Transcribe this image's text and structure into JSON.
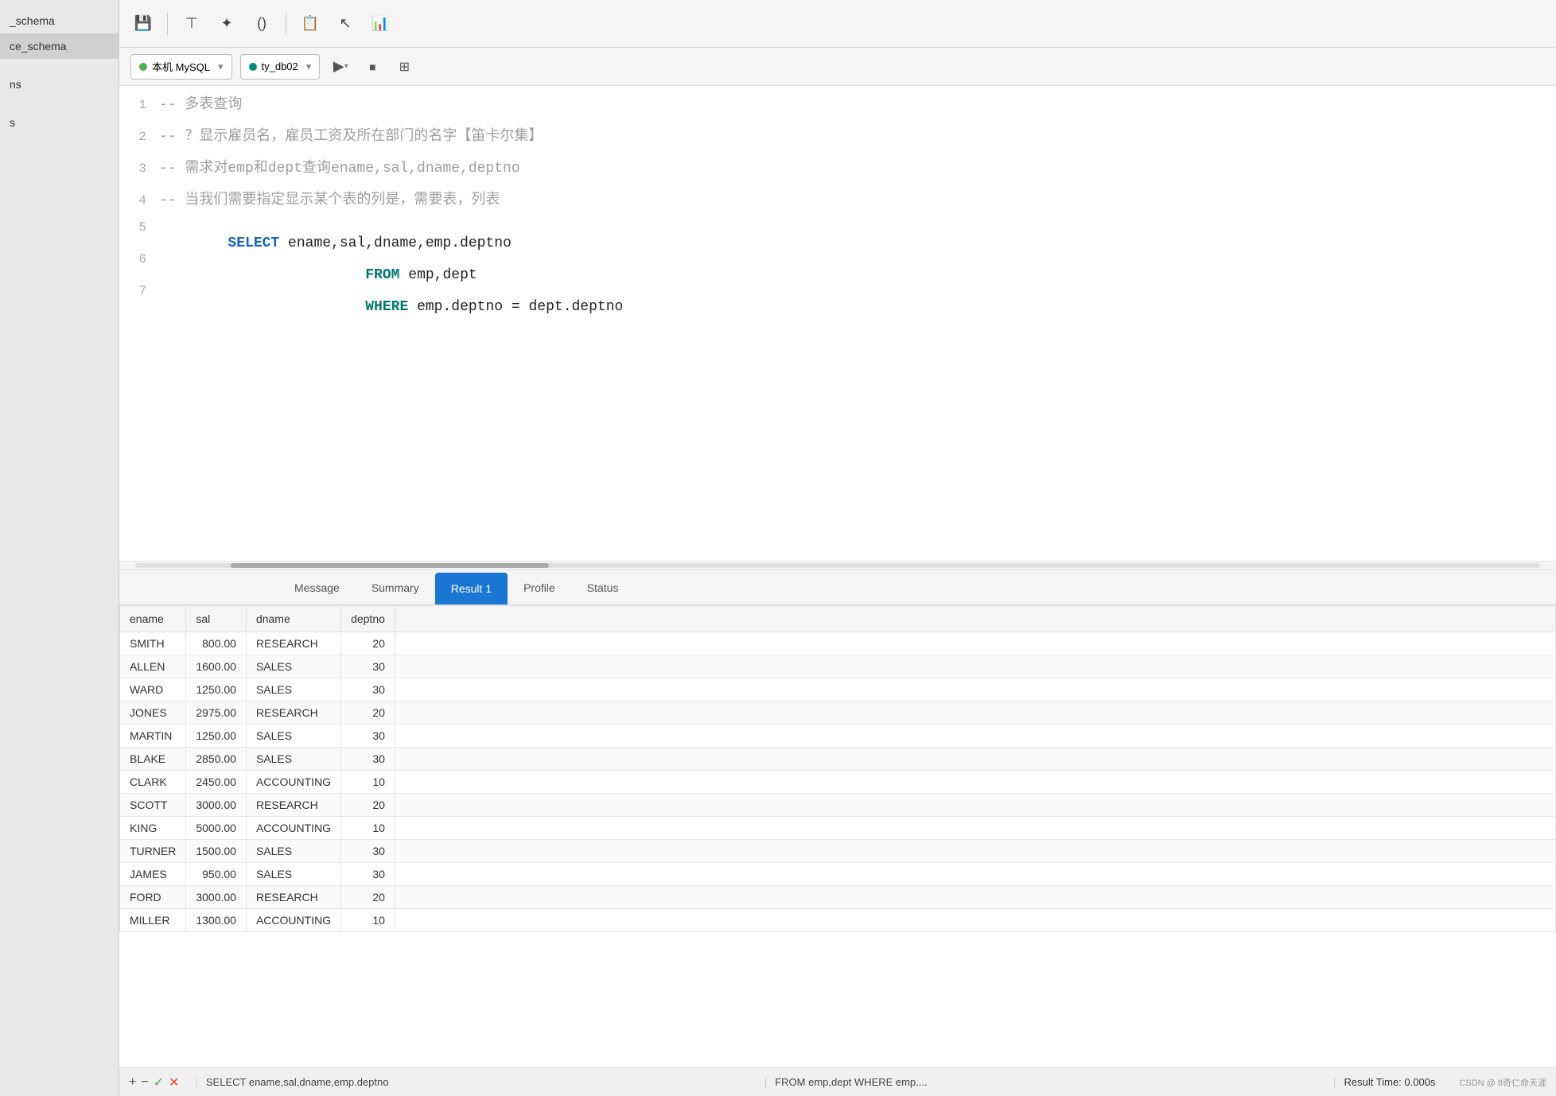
{
  "sidebar": {
    "items": [
      {
        "label": "_schema",
        "selected": false
      },
      {
        "label": "ce_schema",
        "selected": true
      },
      {
        "label": "",
        "selected": false
      },
      {
        "label": "ns",
        "selected": false
      },
      {
        "label": "",
        "selected": false
      },
      {
        "label": "s",
        "selected": false
      }
    ]
  },
  "toolbar": {
    "save_icon": "💾",
    "format_icon": "⊤",
    "magic_icon": "✦",
    "paren_icon": "()",
    "copy_icon": "📋",
    "cursor_icon": "↖",
    "chart_icon": "📊"
  },
  "connection": {
    "mysql_label": "本机 MySQL",
    "db_label": "ty_db02",
    "run_icon": "▶",
    "stop_icon": "■",
    "explain_icon": "⊞"
  },
  "editor": {
    "lines": [
      {
        "num": 1,
        "tokens": [
          {
            "type": "comment",
            "text": "-- 多表查询"
          }
        ]
      },
      {
        "num": 2,
        "tokens": [
          {
            "type": "comment",
            "text": "-- ？显示雇员名，雇员工资及所在部门的名字【笛卡尔集】"
          }
        ]
      },
      {
        "num": 3,
        "tokens": [
          {
            "type": "comment",
            "text": "-- 需求对emp和dept查询ename,sal,dname,deptno"
          }
        ]
      },
      {
        "num": 4,
        "tokens": [
          {
            "type": "comment",
            "text": "-- 当我们需要指定显示某个表的列是，需要表，列表"
          }
        ]
      },
      {
        "num": 5,
        "tokens": [
          {
            "type": "keyword-blue",
            "text": "SELECT"
          },
          {
            "type": "normal",
            "text": " ename,sal,dname,emp.deptno"
          }
        ]
      },
      {
        "num": 6,
        "tokens": [
          {
            "type": "keyword-teal",
            "text": "            FROM"
          },
          {
            "type": "normal",
            "text": " emp,dept"
          }
        ]
      },
      {
        "num": 7,
        "tokens": [
          {
            "type": "keyword-teal",
            "text": "            WHERE"
          },
          {
            "type": "normal",
            "text": " emp.deptno = dept.deptno"
          }
        ]
      }
    ]
  },
  "result_tabs": [
    {
      "label": "Message",
      "active": false
    },
    {
      "label": "Summary",
      "active": false
    },
    {
      "label": "Result 1",
      "active": true
    },
    {
      "label": "Profile",
      "active": false
    },
    {
      "label": "Status",
      "active": false
    }
  ],
  "table": {
    "columns": [
      "ename",
      "sal",
      "dname",
      "deptno"
    ],
    "rows": [
      [
        "SMITH",
        "800.00",
        "RESEARCH",
        "20"
      ],
      [
        "ALLEN",
        "1600.00",
        "SALES",
        "30"
      ],
      [
        "WARD",
        "1250.00",
        "SALES",
        "30"
      ],
      [
        "JONES",
        "2975.00",
        "RESEARCH",
        "20"
      ],
      [
        "MARTIN",
        "1250.00",
        "SALES",
        "30"
      ],
      [
        "BLAKE",
        "2850.00",
        "SALES",
        "30"
      ],
      [
        "CLARK",
        "2450.00",
        "ACCOUNTING",
        "10"
      ],
      [
        "SCOTT",
        "3000.00",
        "RESEARCH",
        "20"
      ],
      [
        "KING",
        "5000.00",
        "ACCOUNTING",
        "10"
      ],
      [
        "TURNER",
        "1500.00",
        "SALES",
        "30"
      ],
      [
        "JAMES",
        "950.00",
        "SALES",
        "30"
      ],
      [
        "FORD",
        "3000.00",
        "RESEARCH",
        "20"
      ],
      [
        "MILLER",
        "1300.00",
        "ACCOUNTING",
        "10"
      ]
    ]
  },
  "status_bar": {
    "add_icon": "+",
    "remove_icon": "−",
    "check_icon": "✓",
    "close_icon": "✕",
    "sql_text": "SELECT ename,sal,dname,emp.deptno",
    "from_text": "FROM emp,dept WHERE emp....",
    "result_time": "Result Time: 0.000s",
    "watermark": "CSDN @ 8奇仁命天涯"
  }
}
